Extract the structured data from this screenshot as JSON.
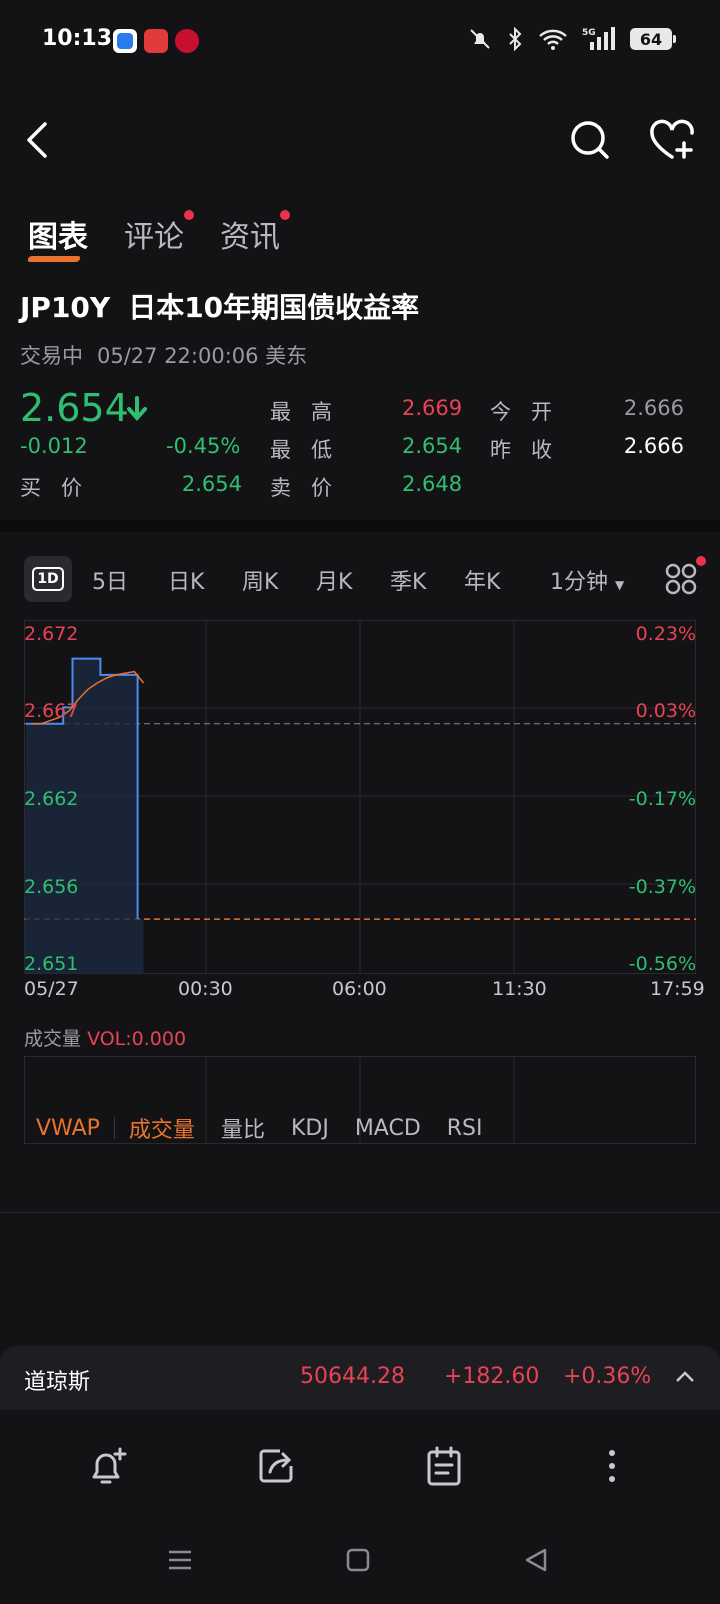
{
  "status": {
    "time": "10:13",
    "battery": "64",
    "network": "5G"
  },
  "tabs": [
    {
      "label": "图表",
      "active": true,
      "dot": false
    },
    {
      "label": "评论",
      "active": false,
      "dot": true
    },
    {
      "label": "资讯",
      "active": false,
      "dot": true
    }
  ],
  "instrument": {
    "code": "JP10Y",
    "name": "日本10年期国债收益率",
    "trade_status": "交易中",
    "datetime": "05/27 22:00:06 美东",
    "price": "2.654",
    "change": "-0.012",
    "change_pct": "-0.45%"
  },
  "quote": {
    "high_label": "最高",
    "high": "2.669",
    "open_label": "今开",
    "open": "2.666",
    "low_label": "最低",
    "low": "2.654",
    "prev_close_label": "昨收",
    "prev_close": "2.666",
    "bid_label": "买价",
    "bid": "2.654",
    "ask_label": "卖价",
    "ask": "2.648"
  },
  "periods": [
    "1D",
    "5日",
    "日K",
    "周K",
    "月K",
    "季K",
    "年K",
    "1分钟"
  ],
  "chart_data": {
    "type": "line",
    "y_left_ticks": [
      "2.672",
      "2.667",
      "2.662",
      "2.656",
      "2.651"
    ],
    "y_right_ticks": [
      "0.23%",
      "0.03%",
      "-0.17%",
      "-0.37%",
      "-0.56%"
    ],
    "x_ticks": [
      "05/27",
      "00:30",
      "06:00",
      "11:30",
      "17:59"
    ],
    "ylim": [
      2.651,
      2.672
    ],
    "prev_close": 2.666,
    "last": 2.654,
    "series": [
      {
        "values": [
          2.666,
          2.666,
          2.666,
          2.666,
          2.667,
          2.67,
          2.67,
          2.67,
          2.669,
          2.669,
          2.669,
          2.669,
          2.654
        ]
      },
      {
        "values": [
          2.666,
          2.666,
          2.6662,
          2.6664,
          2.6668,
          2.6675,
          2.6681,
          2.6685,
          2.6688,
          2.669,
          2.6691,
          2.6692,
          2.6685
        ]
      }
    ]
  },
  "volume": {
    "label": "成交量",
    "value": "VOL:0.000"
  },
  "indicators": [
    "VWAP",
    "成交量",
    "量比",
    "KDJ",
    "MACD",
    "RSI"
  ],
  "ticker": {
    "name": "道琼斯",
    "price": "50644.28",
    "change": "+182.60",
    "change_pct": "+0.36%"
  },
  "colors": {
    "up": "#e84355",
    "down": "#2fbf71",
    "accent": "#e8732d",
    "line": "#4a8cf0"
  }
}
